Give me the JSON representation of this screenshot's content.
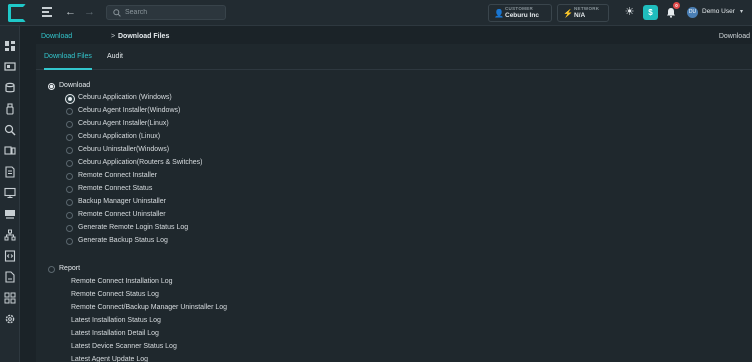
{
  "header": {
    "search_placeholder": "Search",
    "customer": {
      "label": "CUSTOMER",
      "value": "Ceburu Inc"
    },
    "network": {
      "label": "NETWORK",
      "value": "N/A"
    },
    "notification_count": "0",
    "user_name": "Demo User",
    "user_initials": "DU"
  },
  "sidebar": {
    "icons": [
      "dashboard-icon",
      "devices-icon",
      "database-icon",
      "usb-icon",
      "scan-icon",
      "monitor-icon",
      "document-icon",
      "screen-icon",
      "server-icon",
      "network-icon",
      "code-icon",
      "file-icon",
      "apps-icon",
      "settings-icon"
    ]
  },
  "breadcrumb": {
    "parent": "Download",
    "separator": ">",
    "current": "Download Files",
    "page_title": "Download"
  },
  "tabs": [
    {
      "label": "Download Files",
      "active": true
    },
    {
      "label": "Audit",
      "active": false
    }
  ],
  "download_group": {
    "label": "Download",
    "options": [
      "Ceburu Application (Windows)",
      "Ceburu Agent Installer(Windows)",
      "Ceburu Agent Installer(Linux)",
      "Ceburu Application (Linux)",
      "Ceburu Uninstaller(Windows)",
      "Ceburu Application(Routers & Switches)",
      "Remote Connect Installer",
      "Remote Connect Status",
      "Backup Manager Uninstaller",
      "Remote Connect Uninstaller",
      "Generate Remote Login Status Log",
      "Generate Backup Status Log"
    ],
    "selected_index": 0
  },
  "report_group": {
    "label": "Report",
    "options": [
      "Remote Connect Installation Log",
      "Remote Connect Status Log",
      "Remote Connect/Backup Manager Uninstaller Log",
      "Latest Installation Status Log",
      "Latest Installation Detail Log",
      "Latest Device Scanner Status Log",
      "Latest Agent Update Log"
    ]
  },
  "colors": {
    "accent": "#33c7ce",
    "background": "#1b2328",
    "panel": "#1f282d"
  }
}
